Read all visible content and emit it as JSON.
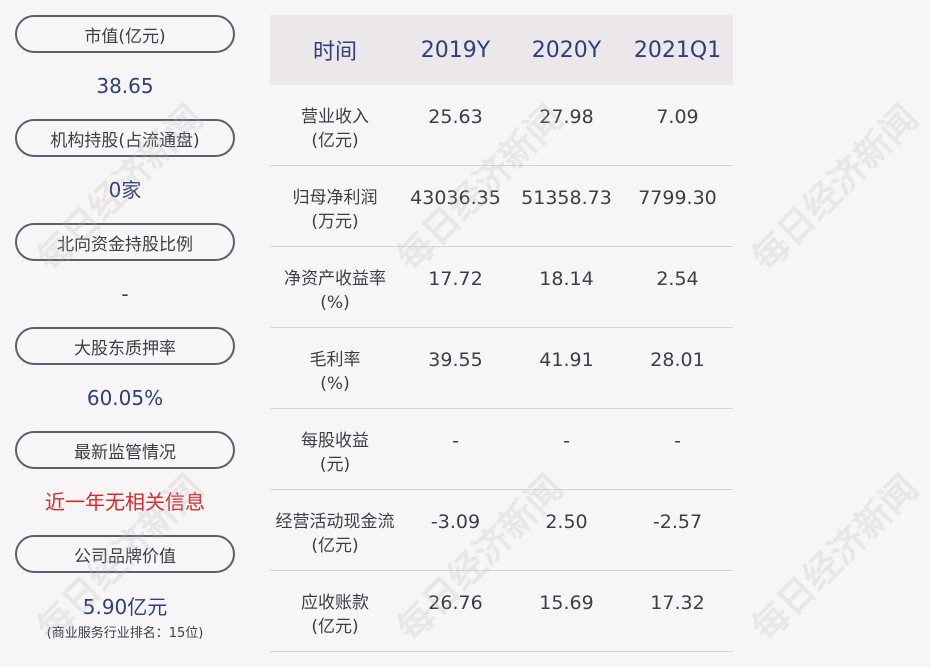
{
  "left": [
    {
      "label": "市值(亿元)",
      "value": "38.65"
    },
    {
      "label": "机构持股(占流通盘)",
      "value": "0家"
    },
    {
      "label": "北向资金持股比例",
      "value": "-"
    },
    {
      "label": "大股东质押率",
      "value": "60.05%"
    },
    {
      "label": "最新监管情况",
      "value": "近一年无相关信息",
      "value_color": "#d62a2a"
    },
    {
      "label": "公司品牌价值",
      "value": "5.90亿元",
      "sub": "(商业服务行业排名：15位)"
    }
  ],
  "table": {
    "headers": [
      "时间",
      "2019Y",
      "2020Y",
      "2021Q1"
    ],
    "rows": [
      {
        "label1": "营业收入",
        "label2": "(亿元)",
        "values": [
          "25.63",
          "27.98",
          "7.09"
        ]
      },
      {
        "label1": "归母净利润",
        "label2": "(万元)",
        "values": [
          "43036.35",
          "51358.73",
          "7799.30"
        ]
      },
      {
        "label1": "净资产收益率",
        "label2": "(%)",
        "values": [
          "17.72",
          "18.14",
          "2.54"
        ]
      },
      {
        "label1": "毛利率",
        "label2": "(%)",
        "values": [
          "39.55",
          "41.91",
          "28.01"
        ]
      },
      {
        "label1": "每股收益",
        "label2": "(元)",
        "values": [
          "-",
          "-",
          "-"
        ]
      },
      {
        "label1": "经营活动现金流",
        "label2": "(亿元)",
        "values": [
          "-3.09",
          "2.50",
          "-2.57"
        ]
      },
      {
        "label1": "应收账款",
        "label2": "(亿元)",
        "values": [
          "26.76",
          "15.69",
          "17.32"
        ]
      }
    ]
  },
  "watermark": "每日经济新闻",
  "colors": {
    "accent": "#2e3f7d",
    "alert": "#d62a2a",
    "border": "#5b5f6d"
  }
}
